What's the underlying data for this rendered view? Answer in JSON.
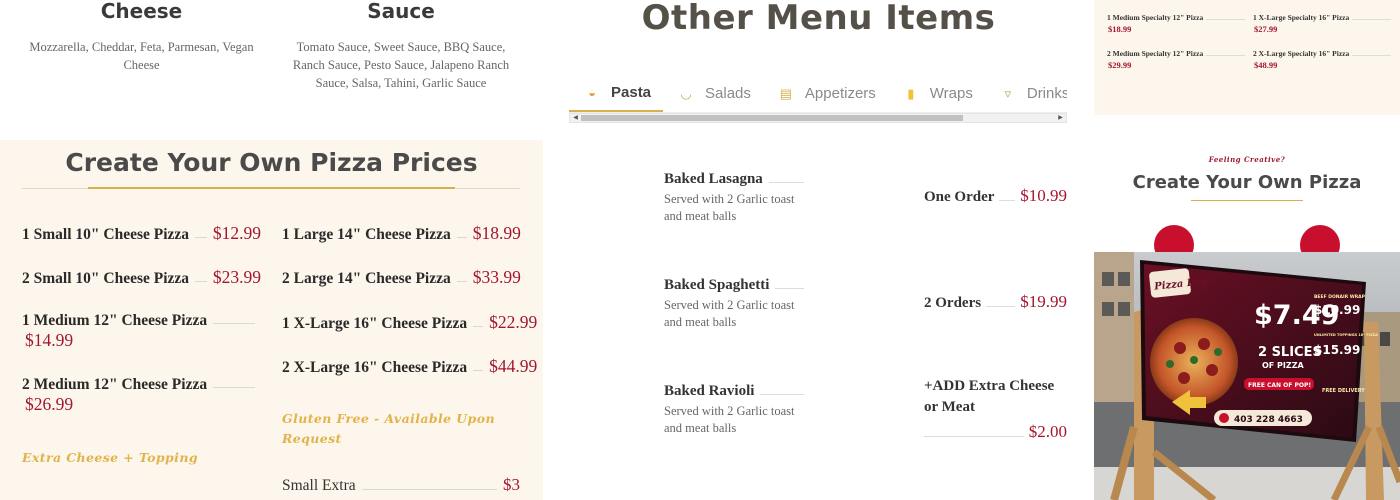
{
  "options": {
    "cheese": {
      "title": "Cheese",
      "desc": "Mozzarella, Cheddar, Feta, Parmesan, Vegan Cheese"
    },
    "sauce": {
      "title": "Sauce",
      "desc": "Tomato Sauce, Sweet Sauce, BBQ Sauce, Ranch Sauce, Pesto Sauce, Jalapeno Ranch Sauce, Salsa, Tahini, Garlic Sauce"
    }
  },
  "cyop": {
    "title": "Create Your Own Pizza Prices",
    "left": [
      {
        "name": "1 Small 10\" Cheese Pizza",
        "price": "$12.99"
      },
      {
        "name": "2 Small 10\" Cheese Pizza",
        "price": "$23.99"
      },
      {
        "name": "1 Medium 12\" Cheese Pizza",
        "price": "$14.99"
      },
      {
        "name": "2 Medium 12\" Cheese Pizza",
        "price": "$26.99"
      }
    ],
    "right": [
      {
        "name": "1 Large 14\" Cheese Pizza",
        "price": "$18.99"
      },
      {
        "name": "2 Large 14\" Cheese Pizza",
        "price": "$33.99"
      },
      {
        "name": "1 X-Large 16\" Cheese Pizza",
        "price": "$22.99"
      },
      {
        "name": "2 X-Large 16\" Cheese Pizza",
        "price": "$44.99"
      }
    ],
    "gluten_note": "Gluten Free - Available Upon Request",
    "extra_note": "Extra Cheese + Topping",
    "small_extra": {
      "name": "Small Extra",
      "price": "$3"
    }
  },
  "other_menu": {
    "title": "Other Menu Items",
    "tabs": [
      {
        "label": "Pasta",
        "icon": "pasta-icon",
        "glyph": "◒"
      },
      {
        "label": "Salads",
        "icon": "salad-icon",
        "glyph": "◡"
      },
      {
        "label": "Appetizers",
        "icon": "appetizer-icon",
        "glyph": "▤"
      },
      {
        "label": "Wraps",
        "icon": "wrap-icon",
        "glyph": "▮"
      },
      {
        "label": "Drinks",
        "icon": "drink-icon",
        "glyph": "▿"
      }
    ],
    "dishes": [
      {
        "name": "Baked Lasagna",
        "desc": "Served with 2 Garlic toast and meat balls"
      },
      {
        "name": "Baked Spaghetti",
        "desc": "Served with 2 Garlic toast and meat balls"
      },
      {
        "name": "Baked Ravioli",
        "desc": "Served with 2 Garlic toast and meat balls"
      }
    ],
    "orders": [
      {
        "name": "One Order",
        "price": "$10.99"
      },
      {
        "name": "2 Orders",
        "price": "$19.99"
      }
    ],
    "extra": {
      "name": "+ADD Extra Cheese or Meat",
      "price": "$2.00"
    }
  },
  "specialty": [
    {
      "name": "1 Medium Specialty 12\" Pizza",
      "price": "$18.99"
    },
    {
      "name": "1 X-Large Specialty 16\" Pizza",
      "price": "$27.99"
    },
    {
      "name": "2 Medium Specialty 12\" Pizza",
      "price": "$29.99"
    },
    {
      "name": "2 X-Large Specialty 16\" Pizza",
      "price": "$48.99"
    }
  ],
  "right_promo": {
    "kicker": "Feeling Creative?",
    "title": "Create Your Own Pizza"
  },
  "billboard": {
    "brand": "Pizza Day",
    "price_main": "$7.49",
    "slices": "2 SLICES",
    "slices_sub": "OF PIZZA",
    "free_pop": "FREE CAN OF POP!",
    "donair_label": "BEEF DONAIR WRAP",
    "donair_price": "$10.99",
    "unlimited_label": "UNLIMITED TOPPINGS 16\" PIZZA",
    "unlimited_price": "$15.99",
    "phone": "403 228 4663",
    "delivery": "FREE DELIVERY"
  },
  "colors": {
    "accent_gold": "#d9b04f",
    "price_red": "#a3162e",
    "cream_bg": "#fdf6ec"
  }
}
